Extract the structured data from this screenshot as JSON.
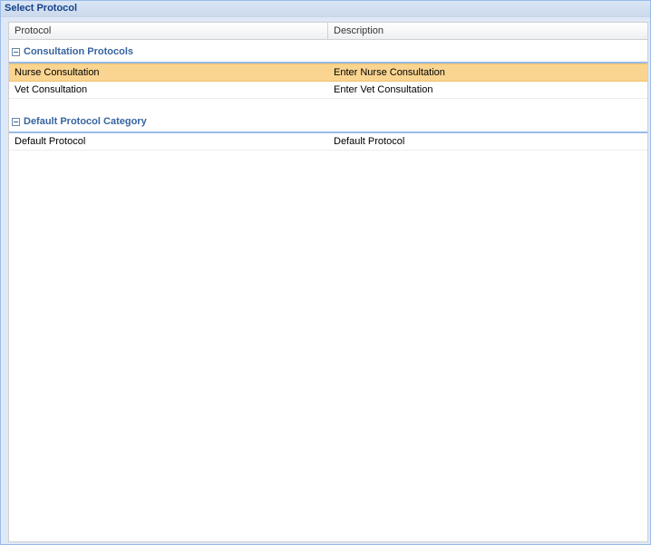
{
  "window": {
    "title": "Select Protocol"
  },
  "grid": {
    "columns": {
      "protocol": "Protocol",
      "description": "Description"
    },
    "groups": [
      {
        "name": "Consultation Protocols",
        "rows": [
          {
            "protocol": "Nurse Consultation",
            "description": "Enter Nurse Consultation",
            "selected": true
          },
          {
            "protocol": "Vet Consultation",
            "description": "Enter Vet Consultation",
            "selected": false
          }
        ]
      },
      {
        "name": "Default Protocol Category",
        "rows": [
          {
            "protocol": "Default Protocol",
            "description": "Default Protocol",
            "selected": false
          }
        ]
      }
    ]
  },
  "colors": {
    "selected_row": "#fad591",
    "group_text": "#3764a0",
    "title_text": "#15428b"
  },
  "icons": {
    "group_toggle": "collapse-minus-icon"
  }
}
